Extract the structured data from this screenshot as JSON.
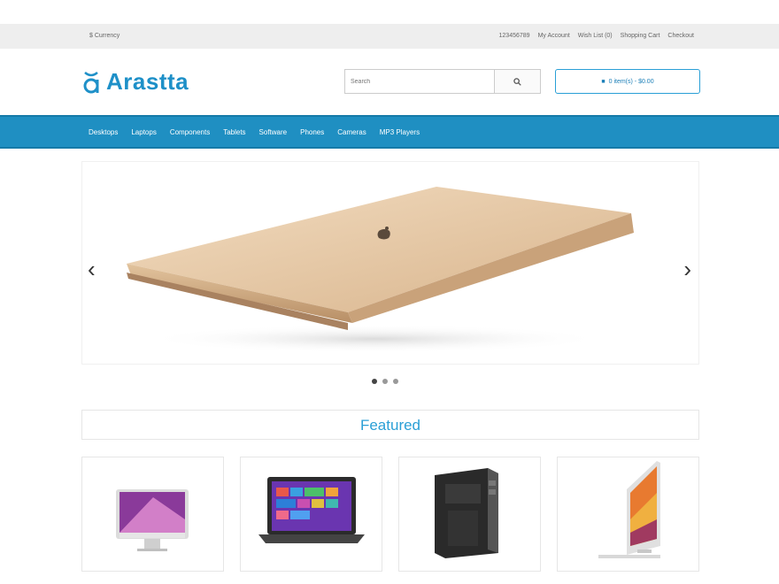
{
  "topbar": {
    "currency": "$ Currency",
    "links": [
      "123456789",
      "My Account",
      "Wish List (0)",
      "Shopping Cart",
      "Checkout"
    ]
  },
  "header": {
    "logo_text": "Arastta",
    "search_placeholder": "Search",
    "cart_label": "0 item(s) - $0.00"
  },
  "nav": {
    "items": [
      "Desktops",
      "Laptops",
      "Components",
      "Tablets",
      "Software",
      "Phones",
      "Cameras",
      "MP3 Players"
    ]
  },
  "slider": {
    "prev": "‹",
    "next": "›",
    "slide_count": 3,
    "active_slide": 1
  },
  "featured": {
    "title": "Featured"
  },
  "products": [
    {
      "icon": "imac-icon"
    },
    {
      "icon": "laptop-icon"
    },
    {
      "icon": "tower-pc-icon"
    },
    {
      "icon": "imac-side-icon"
    }
  ],
  "colors": {
    "accent": "#1f8fc2",
    "topbar_bg": "#eeeeee"
  }
}
